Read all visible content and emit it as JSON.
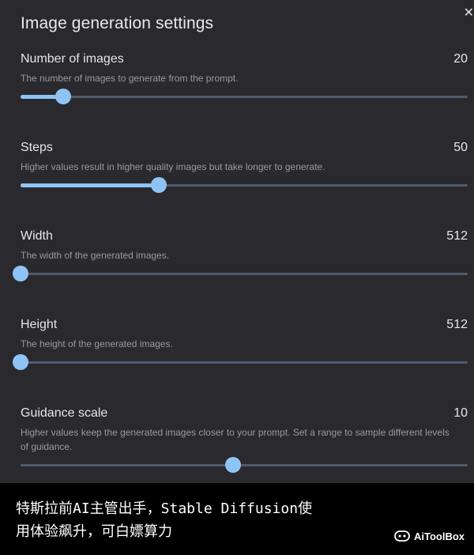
{
  "dialog": {
    "title": "Image generation settings",
    "close_symbol": "✕"
  },
  "settings": [
    {
      "label": "Number of images",
      "value": "20",
      "description": "The number of images to generate from the prompt.",
      "slider_fraction": 0.095
    },
    {
      "label": "Steps",
      "value": "50",
      "description": "Higher values result in higher quality images but take longer to generate.",
      "slider_fraction": 0.31
    },
    {
      "label": "Width",
      "value": "512",
      "description": "The width of the generated images.",
      "slider_fraction": 0.0
    },
    {
      "label": "Height",
      "value": "512",
      "description": "The height of the generated images.",
      "slider_fraction": 0.0
    },
    {
      "label": "Guidance scale",
      "value": "10",
      "description": "Higher values keep the generated images closer to your prompt. Set a range to sample different levels of guidance.",
      "slider_fraction": 0.475
    }
  ],
  "caption": {
    "line1": "特斯拉前AI主管出手，Stable Diffusion使",
    "line2": "用体验飙升，可白嫖算力"
  },
  "brand": {
    "name": "AiToolBox",
    "icon": "aitoolbox-logo-icon"
  },
  "colors": {
    "background": "#2a292e",
    "accent": "#8ec4f5",
    "track": "#4e5b6b"
  }
}
